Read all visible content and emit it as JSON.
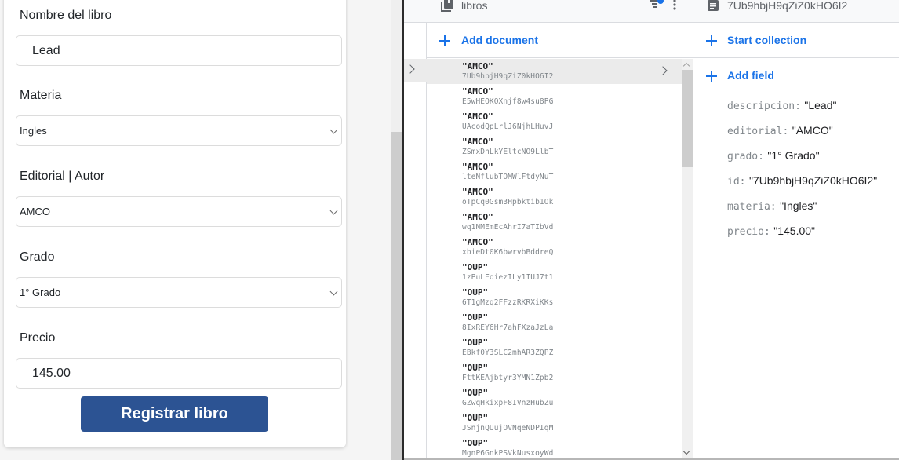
{
  "form": {
    "fields": [
      {
        "label": "Nombre del libro",
        "type": "input",
        "value": "Lead"
      },
      {
        "label": "Materia",
        "type": "select",
        "value": "Ingles"
      },
      {
        "label": "Editorial | Autor",
        "type": "select",
        "value": "AMCO"
      },
      {
        "label": "Grado",
        "type": "select",
        "value": "1° Grado"
      },
      {
        "label": "Precio",
        "type": "input",
        "value": "145.00"
      }
    ],
    "submit_label": "Registrar libro",
    "accent": "#2c5393"
  },
  "firestore": {
    "collection": {
      "title": "libros",
      "icon": "collection-icon",
      "add_document_label": "Add document",
      "documents": [
        {
          "name": "\"AMCO\"",
          "id": "7Ub9hbjH9qZiZ0kHO6I2",
          "selected": true
        },
        {
          "name": "\"AMCO\"",
          "id": "E5wHEOKOXnjf8w4su8PG"
        },
        {
          "name": "\"AMCO\"",
          "id": "UAcodQpLrlJ6NjhLHuvJ"
        },
        {
          "name": "\"AMCO\"",
          "id": "ZSmxDhLkYEltcNO9LlbT"
        },
        {
          "name": "\"AMCO\"",
          "id": "lteNflubTOMWlFtdyNuT"
        },
        {
          "name": "\"AMCO\"",
          "id": "oTpCq0Gsm3Hpbktib1Ok"
        },
        {
          "name": "\"AMCO\"",
          "id": "wq1NMEmEcAhrI7aTIbVd"
        },
        {
          "name": "\"AMCO\"",
          "id": "xbieDt0K6bwrvbBddreQ"
        },
        {
          "name": "\"OUP\"",
          "id": "1zPuLEoiezILy1IUJ7t1"
        },
        {
          "name": "\"OUP\"",
          "id": "6T1gMzq2FFzzRKRXiKKs"
        },
        {
          "name": "\"OUP\"",
          "id": "8IxREY6Hr7ahFXzaJzLa"
        },
        {
          "name": "\"OUP\"",
          "id": "EBkf0Y3SLC2mhAR3ZQPZ"
        },
        {
          "name": "\"OUP\"",
          "id": "FttKEAjbtyr3YMN1Zpb2"
        },
        {
          "name": "\"OUP\"",
          "id": "GZwqHkixpF8IVnzHubZu"
        },
        {
          "name": "\"OUP\"",
          "id": "JSnjnQUujOVNqeNDPIqM"
        },
        {
          "name": "\"OUP\"",
          "id": "MgnP6GnkPSVkNusxoyWd"
        }
      ]
    },
    "document": {
      "title": "7Ub9hbjH9qZiZ0kHO6I2",
      "icon": "document-icon",
      "start_collection_label": "Start collection",
      "add_field_label": "Add field",
      "fields": [
        {
          "key": "descripcion:",
          "value": "\"Lead\""
        },
        {
          "key": "editorial:",
          "value": "\"AMCO\""
        },
        {
          "key": "grado:",
          "value": "\"1° Grado\""
        },
        {
          "key": "id:",
          "value": "\"7Ub9hbjH9qZiZ0kHO6I2\""
        },
        {
          "key": "materia:",
          "value": "\"Ingles\""
        },
        {
          "key": "precio:",
          "value": "\"145.00\""
        }
      ]
    },
    "link_color": "#1a73e8"
  }
}
